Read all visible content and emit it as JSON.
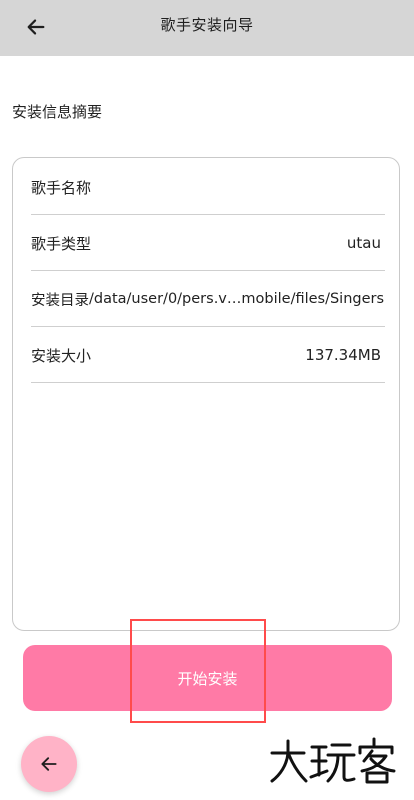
{
  "header": {
    "title": "歌手安装向导",
    "back_icon": "arrow-left-icon"
  },
  "summary": {
    "label": "安装信息摘要",
    "rows": [
      {
        "key": "歌手名称",
        "value": ""
      },
      {
        "key": "歌手类型",
        "value": "utau"
      },
      {
        "key": "安装目录",
        "value": "/data/user/0/pers.v…mobile/files/Singers"
      },
      {
        "key": "安装大小",
        "value": "137.34MB"
      }
    ]
  },
  "actions": {
    "install_label": "开始安装",
    "fab_back_icon": "arrow-left-icon"
  },
  "watermark": {
    "text": "大玩客"
  },
  "colors": {
    "topbar": "#d6d6d6",
    "primary": "#ff7aa6",
    "fab": "#ffb3c7",
    "highlight": "#ff4b4b"
  }
}
